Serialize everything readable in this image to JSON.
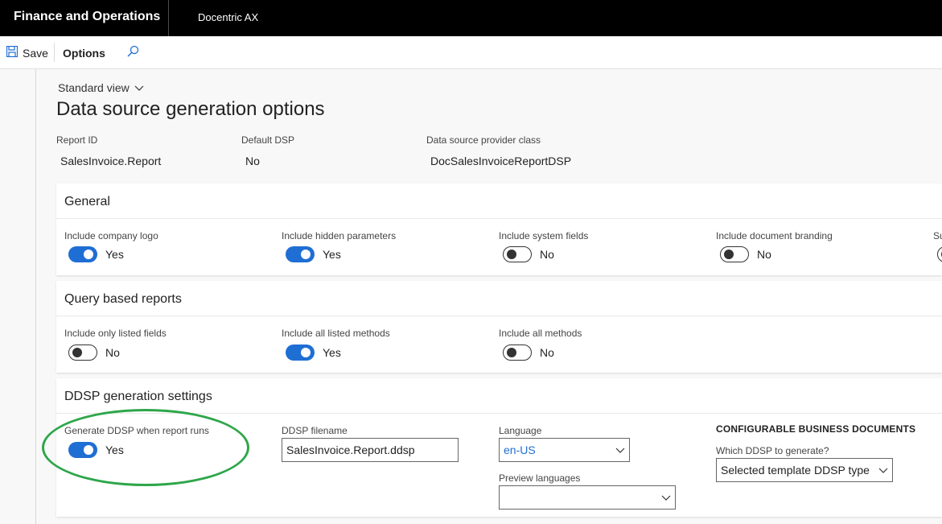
{
  "nav": {
    "app_title": "Finance and Operations",
    "company": "Docentric AX"
  },
  "actions": {
    "save": "Save",
    "options": "Options"
  },
  "view": {
    "label": "Standard view"
  },
  "page": {
    "title": "Data source generation options"
  },
  "header_fields": {
    "report_id": {
      "label": "Report ID",
      "value": "SalesInvoice.Report"
    },
    "default_dsp": {
      "label": "Default DSP",
      "value": "No"
    },
    "dsp_class": {
      "label": "Data source provider class",
      "value": "DocSalesInvoiceReportDSP"
    }
  },
  "general": {
    "title": "General",
    "fields": [
      {
        "label": "Include company logo",
        "state": "Yes"
      },
      {
        "label": "Include hidden parameters",
        "state": "Yes"
      },
      {
        "label": "Include system fields",
        "state": "No"
      },
      {
        "label": "Include document branding",
        "state": "No"
      },
      {
        "label": "Su",
        "state": ""
      }
    ]
  },
  "query": {
    "title": "Query based reports",
    "fields": [
      {
        "label": "Include only listed fields",
        "state": "No"
      },
      {
        "label": "Include all listed methods",
        "state": "Yes"
      },
      {
        "label": "Include all methods",
        "state": "No"
      }
    ]
  },
  "ddsp": {
    "title": "DDSP generation settings",
    "generate": {
      "label": "Generate DDSP when report runs",
      "state": "Yes"
    },
    "filename": {
      "label": "DDSP filename",
      "value": "SalesInvoice.Report.ddsp"
    },
    "language": {
      "label": "Language",
      "value": "en-US"
    },
    "preview": {
      "label": "Preview languages",
      "value": ""
    },
    "cbd": {
      "title": "CONFIGURABLE BUSINESS DOCUMENTS",
      "which_label": "Which DDSP to generate?",
      "which_value": "Selected template DDSP type"
    }
  },
  "colors": {
    "accent": "#1f6ed4",
    "highlight": "#2ea64a",
    "topbar": "#000000"
  }
}
